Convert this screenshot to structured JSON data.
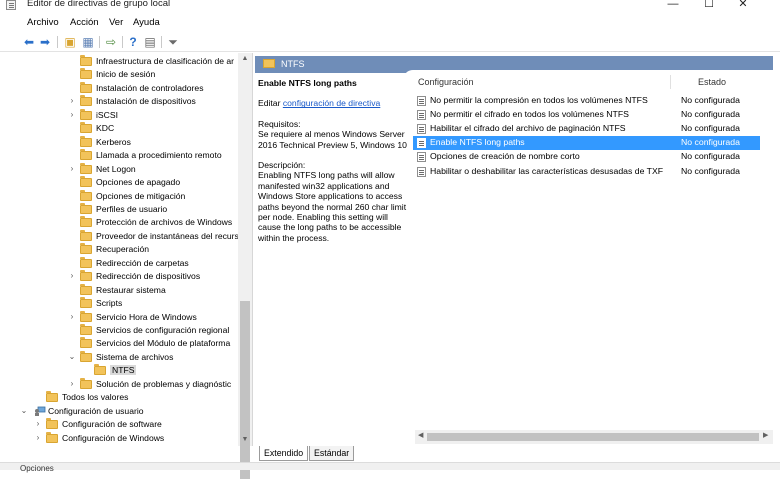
{
  "window": {
    "title": "Editor de directivas de grupo local",
    "controls": {
      "minimize": "—",
      "maximize": "☐",
      "close": "✕"
    }
  },
  "menu": [
    "Archivo",
    "Acción",
    "Ver",
    "Ayuda"
  ],
  "toolbar_icons": [
    "back-arrow-icon",
    "forward-arrow-icon",
    "up-folder-icon",
    "show-hide-tree-icon",
    "export-list-icon",
    "help-icon",
    "properties-icon",
    "filter-icon"
  ],
  "tree": {
    "items": [
      {
        "label": "Infraestructura de clasificación de ar",
        "expander": "",
        "level": 2
      },
      {
        "label": "Inicio de sesión",
        "expander": "",
        "level": 2
      },
      {
        "label": "Instalación de controladores",
        "expander": "",
        "level": 2
      },
      {
        "label": "Instalación de dispositivos",
        "expander": "›",
        "level": 2
      },
      {
        "label": "iSCSI",
        "expander": "›",
        "level": 2
      },
      {
        "label": "KDC",
        "expander": "",
        "level": 2
      },
      {
        "label": "Kerberos",
        "expander": "",
        "level": 2
      },
      {
        "label": "Llamada a procedimiento remoto",
        "expander": "",
        "level": 2
      },
      {
        "label": "Net Logon",
        "expander": "›",
        "level": 2
      },
      {
        "label": "Opciones de apagado",
        "expander": "",
        "level": 2
      },
      {
        "label": "Opciones de mitigación",
        "expander": "",
        "level": 2
      },
      {
        "label": "Perfiles de usuario",
        "expander": "",
        "level": 2
      },
      {
        "label": "Protección de archivos de Windows",
        "expander": "",
        "level": 2
      },
      {
        "label": "Proveedor de instantáneas del recurs",
        "expander": "",
        "level": 2
      },
      {
        "label": "Recuperación",
        "expander": "",
        "level": 2
      },
      {
        "label": "Redirección de carpetas",
        "expander": "",
        "level": 2
      },
      {
        "label": "Redirección de dispositivos",
        "expander": "›",
        "level": 2
      },
      {
        "label": "Restaurar sistema",
        "expander": "",
        "level": 2
      },
      {
        "label": "Scripts",
        "expander": "",
        "level": 2
      },
      {
        "label": "Servicio Hora de Windows",
        "expander": "›",
        "level": 2
      },
      {
        "label": "Servicios de configuración regional",
        "expander": "",
        "level": 2
      },
      {
        "label": "Servicios del Módulo de plataforma",
        "expander": "",
        "level": 2
      },
      {
        "label": "Sistema de archivos",
        "expander": "⌄",
        "level": 2
      },
      {
        "label": "NTFS",
        "expander": "",
        "level": 3,
        "selected": true
      },
      {
        "label": "Solución de problemas y diagnóstic",
        "expander": "›",
        "level": 2
      },
      {
        "label": "Todos los valores",
        "expander": "",
        "level": 1
      },
      {
        "label": "Configuración de usuario",
        "expander": "⌄",
        "level": 0,
        "icon": "user-computer-icon"
      },
      {
        "label": "Configuración de software",
        "expander": "›",
        "level": 1
      },
      {
        "label": "Configuración de Windows",
        "expander": "›",
        "level": 1
      }
    ]
  },
  "details": {
    "header": "NTFS",
    "setting_title": "Enable NTFS long paths",
    "edit_prefix": "Editar",
    "edit_link": "configuración de directiva",
    "requirements_label": "Requisitos:",
    "requirements_text": "Se requiere al menos Windows Server 2016 Technical Preview 5, Windows 10",
    "description_label": "Descripción:",
    "description_text": "Enabling NTFS long paths will allow manifested win32 applications and Windows Store applications to access paths beyond the normal 260 char limit per node.  Enabling this setting will cause the long paths to be accessible within the process."
  },
  "list": {
    "columns": [
      "Configuración",
      "Estado"
    ],
    "rows": [
      {
        "name": "No permitir la compresión en todos los volúmenes NTFS",
        "state": "No configurada",
        "selected": false
      },
      {
        "name": "No permitir el cifrado en todos los volúmenes NTFS",
        "state": "No configurada",
        "selected": false
      },
      {
        "name": "Habilitar el cifrado del archivo de paginación NTFS",
        "state": "No configurada",
        "selected": false
      },
      {
        "name": "Enable NTFS long paths",
        "state": "No configurada",
        "selected": true
      },
      {
        "name": "Opciones de creación de nombre corto",
        "state": "No configurada",
        "selected": false
      },
      {
        "name": "Habilitar o deshabilitar las características desusadas de TXF",
        "state": "No configurada",
        "selected": false
      }
    ]
  },
  "tabs": [
    "Extendido",
    "Estándar"
  ],
  "status": "Opciones",
  "colors": {
    "header_band": "#6f8db8",
    "selection": "#3399ff",
    "folder": "#f2c35a",
    "link": "#1a5ac9"
  }
}
